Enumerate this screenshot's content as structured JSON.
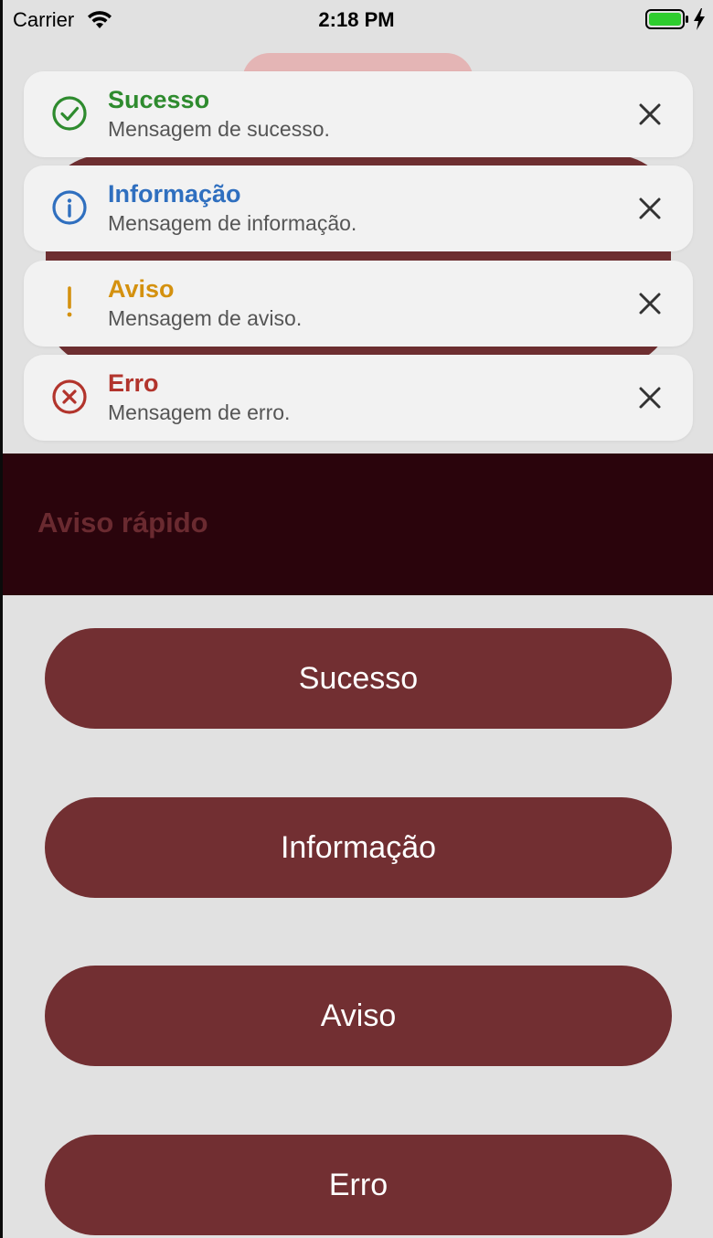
{
  "status_bar": {
    "carrier": "Carrier",
    "time": "2:18 PM",
    "battery_color": "#2ecc2e"
  },
  "toasts": [
    {
      "type": "success",
      "title": "Sucesso",
      "message": "Mensagem de sucesso.",
      "color": "#2e8b2e",
      "icon": "check-circle-icon"
    },
    {
      "type": "info",
      "title": "Informação",
      "message": "Mensagem de informação.",
      "color": "#2f6fbf",
      "icon": "info-circle-icon"
    },
    {
      "type": "warning",
      "title": "Aviso",
      "message": "Mensagem de aviso.",
      "color": "#d4910f",
      "icon": "exclamation-icon"
    },
    {
      "type": "error",
      "title": "Erro",
      "message": "Mensagem de erro.",
      "color": "#b2342c",
      "icon": "x-circle-icon"
    }
  ],
  "header": {
    "title": "Aviso rápido"
  },
  "buttons": [
    {
      "label": "Sucesso"
    },
    {
      "label": "Informação"
    },
    {
      "label": "Aviso"
    },
    {
      "label": "Erro"
    }
  ],
  "colors": {
    "background": "#e1e1e1",
    "button": "#722f32",
    "header_band": "#2a040c",
    "toast_bg": "#f2f2f2"
  }
}
